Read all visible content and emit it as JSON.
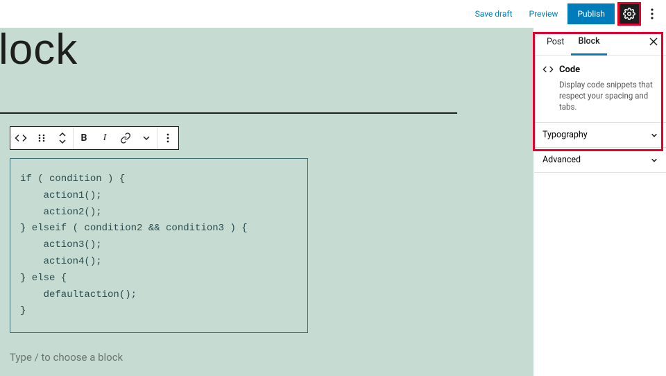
{
  "topbar": {
    "save_draft": "Save draft",
    "preview": "Preview",
    "publish": "Publish"
  },
  "editor": {
    "title": "lock",
    "code": "if ( condition ) {\n    action1();\n    action2();\n} elseif ( condition2 && condition3 ) {\n    action3();\n    action4();\n} else {\n    defaultaction();\n}",
    "placeholder": "Type / to choose a block"
  },
  "sidebar": {
    "tabs": {
      "post": "Post",
      "block": "Block"
    },
    "block_name": "Code",
    "block_desc": "Display code snippets that respect your spacing and tabs.",
    "panel_typography": "Typography",
    "panel_advanced": "Advanced"
  }
}
